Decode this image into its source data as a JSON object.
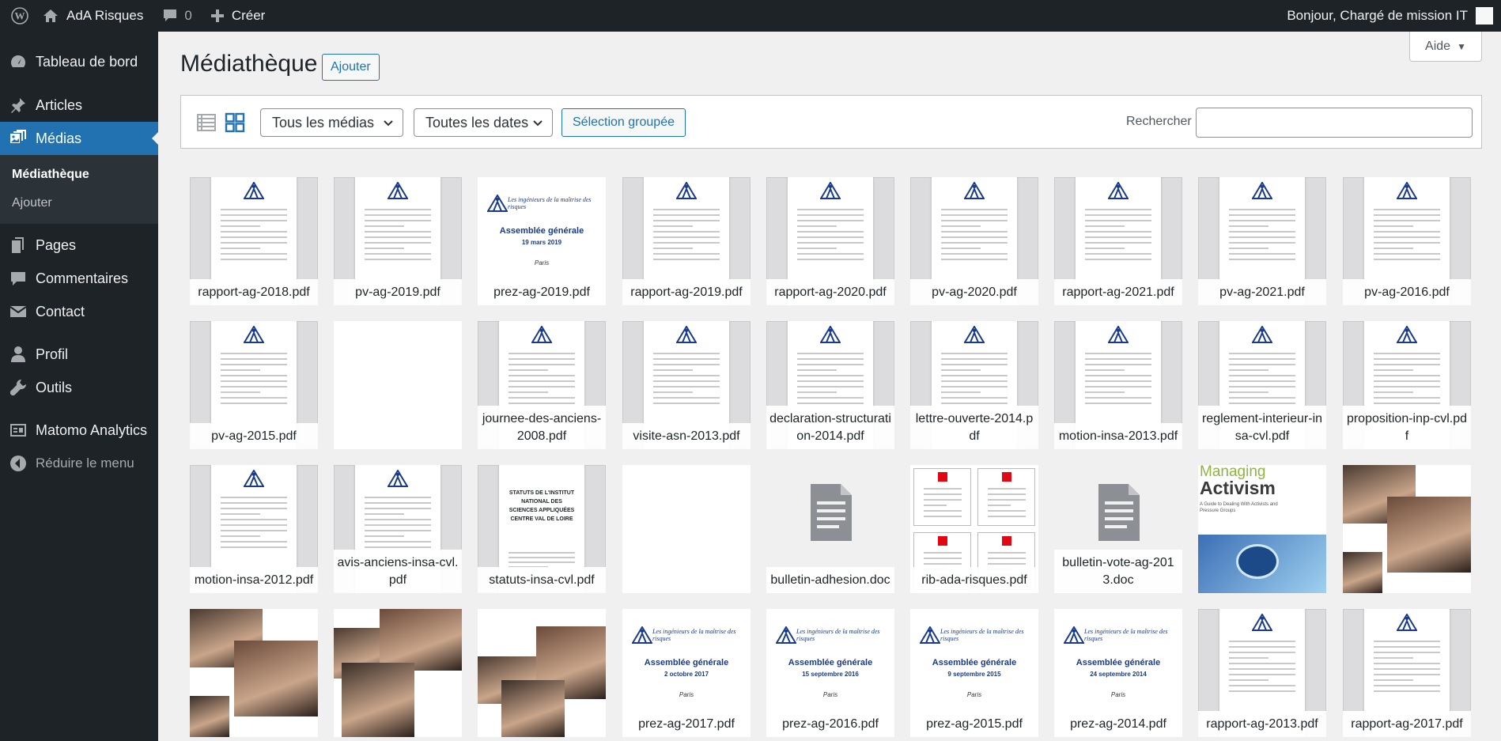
{
  "admin_bar": {
    "site_name": "AdA Risques",
    "comments_count": "0",
    "new_label": "Créer",
    "greeting": "Bonjour, Chargé de mission IT"
  },
  "sidebar": {
    "items": [
      {
        "label": "Tableau de bord",
        "icon": "dashboard-icon"
      },
      {
        "label": "Articles",
        "icon": "pin-icon"
      },
      {
        "label": "Médias",
        "icon": "media-icon"
      },
      {
        "label": "Pages",
        "icon": "pages-icon"
      },
      {
        "label": "Commentaires",
        "icon": "comment-icon"
      },
      {
        "label": "Contact",
        "icon": "email-icon"
      },
      {
        "label": "Profil",
        "icon": "user-icon"
      },
      {
        "label": "Outils",
        "icon": "wrench-icon"
      },
      {
        "label": "Matomo Analytics",
        "icon": "analytics-icon"
      },
      {
        "label": "Réduire le menu",
        "icon": "collapse-icon"
      }
    ],
    "submenu": [
      {
        "label": "Médiathèque"
      },
      {
        "label": "Ajouter"
      }
    ]
  },
  "header": {
    "help": "Aide",
    "title": "Médiathèque",
    "add_button": "Ajouter"
  },
  "toolbar": {
    "media_filter": "Tous les médias",
    "date_filter": "Toutes les dates",
    "bulk_select": "Sélection groupée",
    "search_label": "Rechercher",
    "search_value": ""
  },
  "media": [
    {
      "name": "rapport-ag-2018.pdf",
      "kind": "doc"
    },
    {
      "name": "pv-ag-2019.pdf",
      "kind": "doc"
    },
    {
      "name": "prez-ag-2019.pdf",
      "kind": "slide",
      "slide_title": "Assemblée générale",
      "slide_date": "19 mars 2019",
      "slide_place": "Paris",
      "slide_header": "Les ingénieurs de la maîtrise des risques"
    },
    {
      "name": "rapport-ag-2019.pdf",
      "kind": "doc"
    },
    {
      "name": "rapport-ag-2020.pdf",
      "kind": "doc"
    },
    {
      "name": "pv-ag-2020.pdf",
      "kind": "doc"
    },
    {
      "name": "rapport-ag-2021.pdf",
      "kind": "doc"
    },
    {
      "name": "pv-ag-2021.pdf",
      "kind": "doc"
    },
    {
      "name": "pv-ag-2016.pdf",
      "kind": "doc"
    },
    {
      "name": "pv-ag-2015.pdf",
      "kind": "doc"
    },
    {
      "name": "",
      "kind": "balloon"
    },
    {
      "name": "journee-des-anciens-2008.pdf",
      "kind": "doc"
    },
    {
      "name": "visite-asn-2013.pdf",
      "kind": "doc"
    },
    {
      "name": "declaration-structuration-2014.pdf",
      "kind": "doc"
    },
    {
      "name": "lettre-ouverte-2014.pdf",
      "kind": "doc"
    },
    {
      "name": "motion-insa-2013.pdf",
      "kind": "doc"
    },
    {
      "name": "reglement-interieur-insa-cvl.pdf",
      "kind": "doc"
    },
    {
      "name": "proposition-inp-cvl.pdf",
      "kind": "doc"
    },
    {
      "name": "motion-insa-2012.pdf",
      "kind": "doc"
    },
    {
      "name": "avis-anciens-insa-cvl.pdf",
      "kind": "doc"
    },
    {
      "name": "statuts-insa-cvl.pdf",
      "kind": "doc",
      "doc_heading": "STATUTS DE L'INSTITUT NATIONAL DES SCIENCES APPLIQUÉES CENTRE VAL DE LOIRE"
    },
    {
      "name": "",
      "kind": "evolution"
    },
    {
      "name": "bulletin-adhesion.doc",
      "kind": "generic"
    },
    {
      "name": "rib-ada-risques.pdf",
      "kind": "rib"
    },
    {
      "name": "bulletin-vote-ag-2013.doc",
      "kind": "generic"
    },
    {
      "name": "",
      "kind": "book",
      "book_title_1": "Managing",
      "book_title_2": "Activism",
      "book_subtitle": "A Guide to Dealing With Activists and Pressure Groups"
    },
    {
      "name": "",
      "kind": "photo"
    },
    {
      "name": "",
      "kind": "photo"
    },
    {
      "name": "",
      "kind": "photo"
    },
    {
      "name": "",
      "kind": "photo"
    },
    {
      "name": "prez-ag-2017.pdf",
      "kind": "slide",
      "slide_title": "Assemblée générale",
      "slide_date": "2 octobre 2017",
      "slide_place": "Paris",
      "slide_header": "Les ingénieurs de la maîtrise des risques"
    },
    {
      "name": "prez-ag-2016.pdf",
      "kind": "slide",
      "slide_title": "Assemblée générale",
      "slide_date": "15 septembre 2016",
      "slide_place": "Paris",
      "slide_header": "Les ingénieurs de la maîtrise des risques"
    },
    {
      "name": "prez-ag-2015.pdf",
      "kind": "slide",
      "slide_title": "Assemblée générale",
      "slide_date": "9 septembre 2015",
      "slide_place": "Paris",
      "slide_header": "Les ingénieurs de la maîtrise des risques"
    },
    {
      "name": "prez-ag-2014.pdf",
      "kind": "slide",
      "slide_title": "Assemblée générale",
      "slide_date": "24 septembre 2014",
      "slide_place": "Paris",
      "slide_header": "Les ingénieurs de la maîtrise des risques"
    },
    {
      "name": "rapport-ag-2013.pdf",
      "kind": "doc"
    },
    {
      "name": "rapport-ag-2017.pdf",
      "kind": "doc"
    }
  ],
  "colors": {
    "admin_bg": "#1d2327",
    "accent": "#2271b1",
    "submenu_bg": "#2c3338",
    "page_bg": "#f0f0f1"
  }
}
